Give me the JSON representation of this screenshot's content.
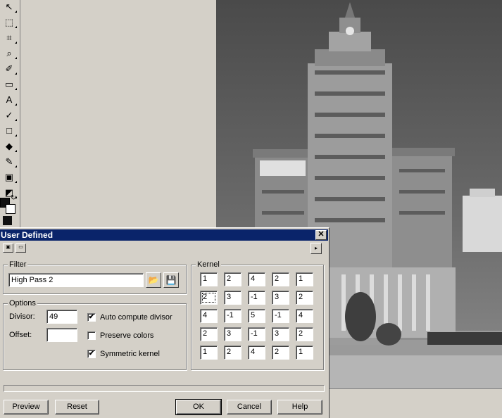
{
  "toolbox": {
    "tools": [
      {
        "name": "pointer-icon",
        "glyph": "↖"
      },
      {
        "name": "selection-icon",
        "glyph": "⬚"
      },
      {
        "name": "crop-icon",
        "glyph": "⌗"
      },
      {
        "name": "zoom-icon",
        "glyph": "⌕"
      },
      {
        "name": "eyedropper-icon",
        "glyph": "✐"
      },
      {
        "name": "eraser-icon",
        "glyph": "▭"
      },
      {
        "name": "text-icon",
        "glyph": "A"
      },
      {
        "name": "clone-icon",
        "glyph": "✓"
      },
      {
        "name": "shape-icon",
        "glyph": "□"
      },
      {
        "name": "fill-icon",
        "glyph": "◆"
      },
      {
        "name": "brush-icon",
        "glyph": "✎"
      },
      {
        "name": "layer-icon",
        "glyph": "▣"
      },
      {
        "name": "adjust-icon",
        "glyph": "◩"
      }
    ]
  },
  "dialog": {
    "title": "User Defined",
    "close_glyph": "✕",
    "expand_glyph": "▸",
    "filter": {
      "group_title": "Filter",
      "name_value": "High Pass 2"
    },
    "options": {
      "group_title": "Options",
      "divisor_label": "Divisor:",
      "divisor_value": "49",
      "offset_label": "Offset:",
      "offset_value": "",
      "auto_compute_label": "Auto compute divisor",
      "auto_compute_checked": true,
      "preserve_colors_label": "Preserve colors",
      "preserve_colors_checked": false,
      "symmetric_label": "Symmetric kernel",
      "symmetric_checked": true
    },
    "kernel": {
      "group_title": "Kernel",
      "rows": [
        [
          "1",
          "2",
          "4",
          "2",
          "1"
        ],
        [
          "2",
          "3",
          "-1",
          "3",
          "2"
        ],
        [
          "4",
          "-1",
          "5",
          "-1",
          "4"
        ],
        [
          "2",
          "3",
          "-1",
          "3",
          "2"
        ],
        [
          "1",
          "2",
          "4",
          "2",
          "1"
        ]
      ]
    },
    "buttons": {
      "preview": "Preview",
      "reset": "Reset",
      "ok": "OK",
      "cancel": "Cancel",
      "help": "Help"
    }
  },
  "colors": {
    "titlebar": "#0a246a",
    "face": "#d4d0c8"
  }
}
